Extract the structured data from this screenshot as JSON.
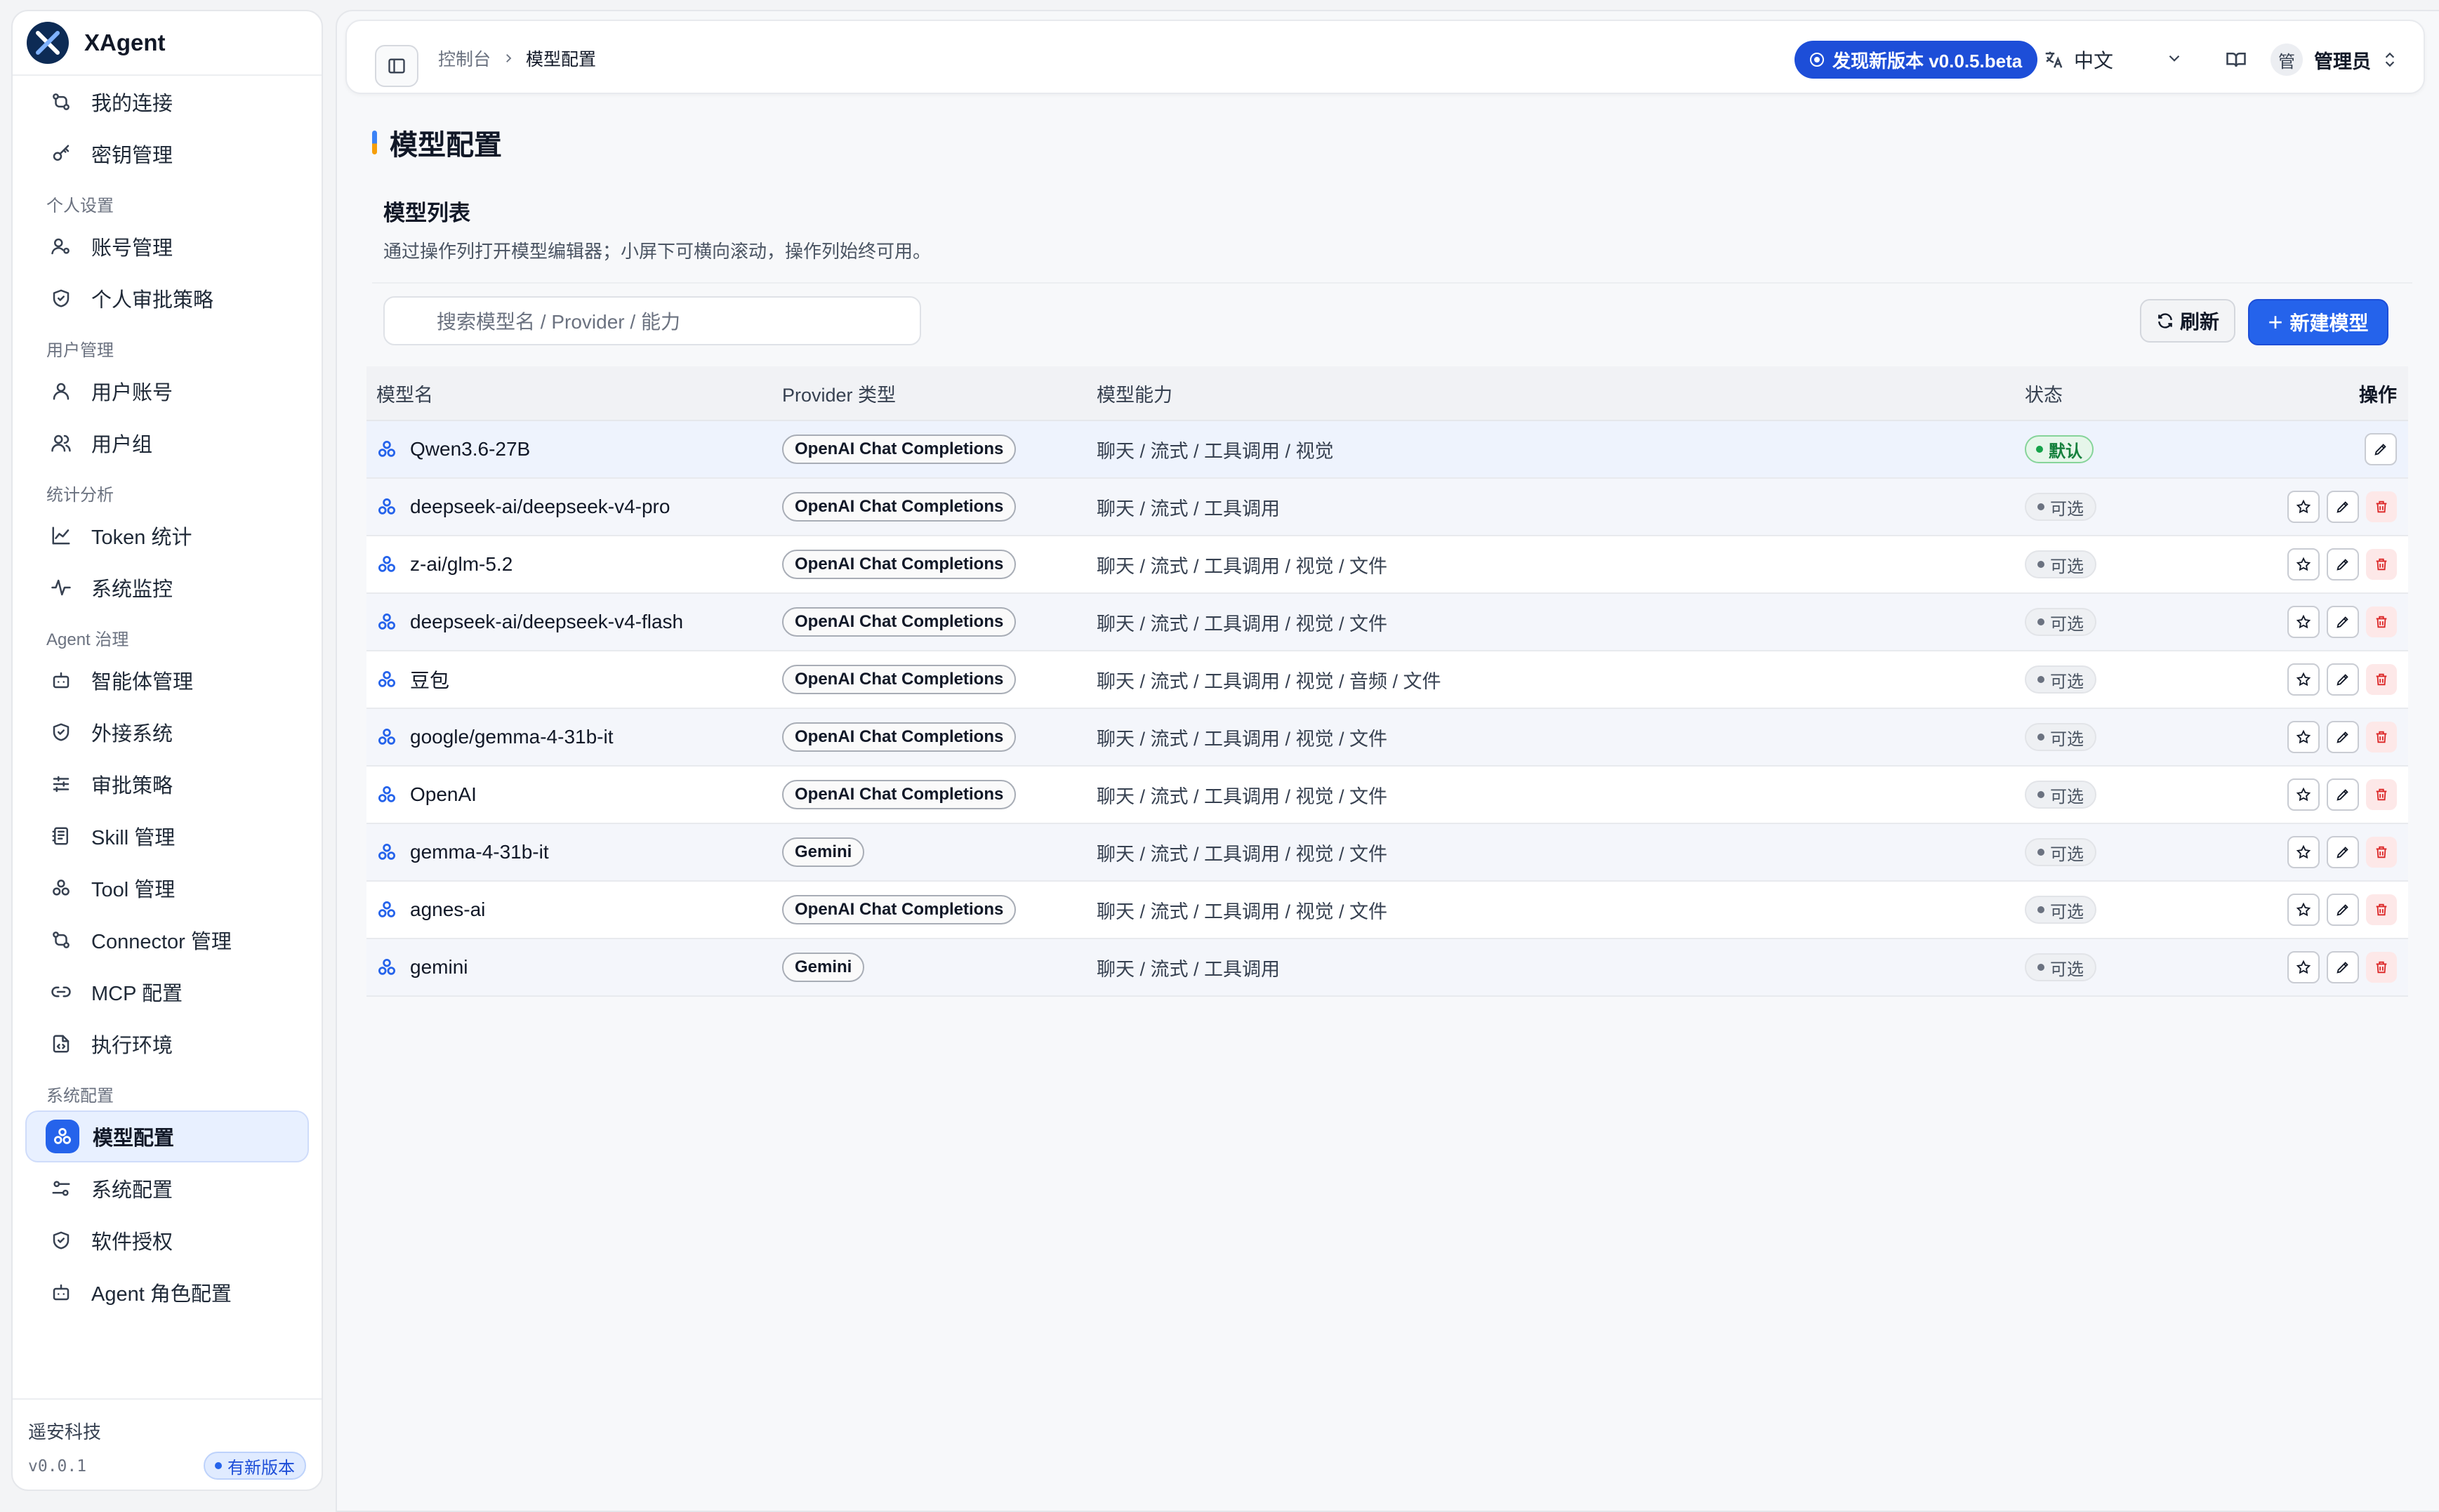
{
  "app": {
    "name": "XAgent"
  },
  "sidebar": {
    "top_items": [
      {
        "label": "我的连接",
        "icon": "connection-icon"
      },
      {
        "label": "密钥管理",
        "icon": "key-icon"
      }
    ],
    "sections": [
      {
        "title": "个人设置",
        "items": [
          {
            "label": "账号管理",
            "icon": "user-settings-icon"
          },
          {
            "label": "个人审批策略",
            "icon": "shield-icon"
          }
        ]
      },
      {
        "title": "用户管理",
        "items": [
          {
            "label": "用户账号",
            "icon": "user-icon"
          },
          {
            "label": "用户组",
            "icon": "users-icon"
          }
        ]
      },
      {
        "title": "统计分析",
        "items": [
          {
            "label": "Token 统计",
            "icon": "line-chart-icon"
          },
          {
            "label": "系统监控",
            "icon": "activity-icon"
          }
        ]
      },
      {
        "title": "Agent 治理",
        "items": [
          {
            "label": "智能体管理",
            "icon": "bot-icon"
          },
          {
            "label": "外接系统",
            "icon": "shield-check-icon"
          },
          {
            "label": "审批策略",
            "icon": "sliders-icon"
          },
          {
            "label": "Skill 管理",
            "icon": "notebook-icon"
          },
          {
            "label": "Tool 管理",
            "icon": "boxes-icon"
          },
          {
            "label": "Connector 管理",
            "icon": "connector-icon"
          },
          {
            "label": "MCP 配置",
            "icon": "link-icon"
          },
          {
            "label": "执行环境",
            "icon": "file-code-icon"
          }
        ]
      },
      {
        "title": "系统配置",
        "items": [
          {
            "label": "模型配置",
            "icon": "model-icon",
            "active": true
          },
          {
            "label": "系统配置",
            "icon": "settings-sliders-icon"
          },
          {
            "label": "软件授权",
            "icon": "shield-license-icon"
          },
          {
            "label": "Agent 角色配置",
            "icon": "bot-role-icon"
          }
        ]
      }
    ],
    "footer": {
      "company": "遥安科技",
      "version": "v0.0.1",
      "update_badge": "有新版本"
    }
  },
  "topbar": {
    "breadcrumb": [
      "控制台",
      "模型配置"
    ],
    "update_label": "发现新版本 v0.0.5.beta",
    "language": "中文",
    "avatar_text": "管",
    "user_name": "管理员"
  },
  "page": {
    "title": "模型配置",
    "list_title": "模型列表",
    "list_desc": "通过操作列打开模型编辑器；小屏下可横向滚动，操作列始终可用。",
    "search_placeholder": "搜索模型名 / Provider / 能力",
    "refresh_label": "刷新",
    "new_label": "新建模型"
  },
  "table": {
    "headers": {
      "name": "模型名",
      "provider": "Provider 类型",
      "capabilities": "模型能力",
      "status": "状态",
      "actions": "操作"
    },
    "rows": [
      {
        "name": "Qwen3.6-27B",
        "provider": "OpenAI Chat Completions",
        "capabilities": "聊天 / 流式 / 工具调用 / 视觉",
        "status": "默认",
        "is_default": true
      },
      {
        "name": "deepseek-ai/deepseek-v4-pro",
        "provider": "OpenAI Chat Completions",
        "capabilities": "聊天 / 流式 / 工具调用",
        "status": "可选"
      },
      {
        "name": "z-ai/glm-5.2",
        "provider": "OpenAI Chat Completions",
        "capabilities": "聊天 / 流式 / 工具调用 / 视觉 / 文件",
        "status": "可选"
      },
      {
        "name": "deepseek-ai/deepseek-v4-flash",
        "provider": "OpenAI Chat Completions",
        "capabilities": "聊天 / 流式 / 工具调用 / 视觉 / 文件",
        "status": "可选"
      },
      {
        "name": "豆包",
        "provider": "OpenAI Chat Completions",
        "capabilities": "聊天 / 流式 / 工具调用 / 视觉 / 音频 / 文件",
        "status": "可选"
      },
      {
        "name": "google/gemma-4-31b-it",
        "provider": "OpenAI Chat Completions",
        "capabilities": "聊天 / 流式 / 工具调用 / 视觉 / 文件",
        "status": "可选"
      },
      {
        "name": "OpenAI",
        "provider": "OpenAI Chat Completions",
        "capabilities": "聊天 / 流式 / 工具调用 / 视觉 / 文件",
        "status": "可选"
      },
      {
        "name": "gemma-4-31b-it",
        "provider": "Gemini",
        "capabilities": "聊天 / 流式 / 工具调用 / 视觉 / 文件",
        "status": "可选"
      },
      {
        "name": "agnes-ai",
        "provider": "OpenAI Chat Completions",
        "capabilities": "聊天 / 流式 / 工具调用 / 视觉 / 文件",
        "status": "可选"
      },
      {
        "name": "gemini",
        "provider": "Gemini",
        "capabilities": "聊天 / 流式 / 工具调用",
        "status": "可选"
      }
    ]
  },
  "colors": {
    "accent": "#2563eb",
    "default_status": "#16a34a",
    "delete": "#dc2626"
  }
}
